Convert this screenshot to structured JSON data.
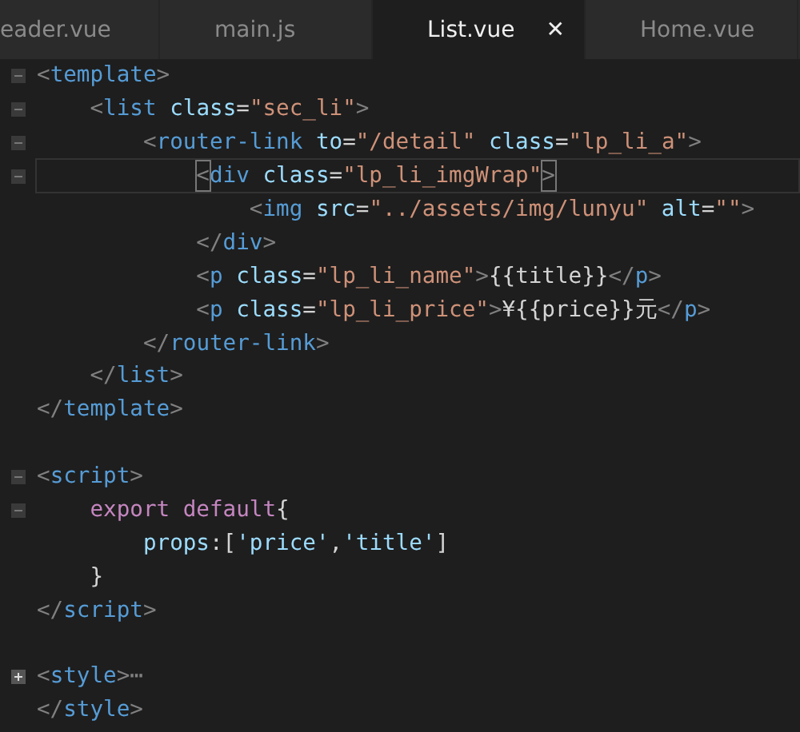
{
  "tabs": [
    {
      "label": "eader.vue",
      "selected": false
    },
    {
      "label": "main.js",
      "selected": false
    },
    {
      "label": "List.vue",
      "selected": true,
      "close": "✕"
    },
    {
      "label": "Home.vue",
      "selected": false
    }
  ],
  "editor": {
    "lines": [
      {
        "expanded": true,
        "current": false,
        "tokens": [
          {
            "kind": "punct",
            "text": "<"
          },
          {
            "kind": "tag",
            "text": "template"
          },
          {
            "kind": "punct",
            "text": ">"
          }
        ]
      },
      {
        "expanded": true,
        "current": false,
        "tokens": [
          {
            "kind": "punct",
            "text": "    <"
          },
          {
            "kind": "tag",
            "text": "list"
          },
          {
            "kind": "attr",
            "text": " class"
          },
          {
            "kind": "text",
            "text": "="
          },
          {
            "kind": "string",
            "text": "\"sec_li\""
          },
          {
            "kind": "punct",
            "text": ">"
          }
        ]
      },
      {
        "expanded": true,
        "current": false,
        "tokens": [
          {
            "kind": "punct",
            "text": "        <"
          },
          {
            "kind": "tag",
            "text": "router-link"
          },
          {
            "kind": "attr",
            "text": " to"
          },
          {
            "kind": "text",
            "text": "="
          },
          {
            "kind": "string",
            "text": "\"/detail\""
          },
          {
            "kind": "attr",
            "text": " class"
          },
          {
            "kind": "text",
            "text": "="
          },
          {
            "kind": "string",
            "text": "\"lp_li_a\""
          },
          {
            "kind": "punct",
            "text": ">"
          }
        ]
      },
      {
        "expanded": true,
        "current": true,
        "tokens": [
          {
            "kind": "match",
            "text": "            <"
          },
          {
            "kind": "tag",
            "text": "div"
          },
          {
            "kind": "attr",
            "text": " class"
          },
          {
            "kind": "text",
            "text": "="
          },
          {
            "kind": "string",
            "text": "\"lp_li_imgWrap\""
          },
          {
            "kind": "match",
            "text": ">"
          }
        ]
      },
      {
        "current": false,
        "tokens": [
          {
            "kind": "punct",
            "text": "                <"
          },
          {
            "kind": "tag",
            "text": "img"
          },
          {
            "kind": "attr",
            "text": " src"
          },
          {
            "kind": "text",
            "text": "="
          },
          {
            "kind": "string",
            "text": "\"../assets/img/lunyu\""
          },
          {
            "kind": "attr",
            "text": " alt"
          },
          {
            "kind": "text",
            "text": "="
          },
          {
            "kind": "string",
            "text": "\"\""
          },
          {
            "kind": "punct",
            "text": ">"
          }
        ]
      },
      {
        "current": false,
        "tokens": [
          {
            "kind": "punct",
            "text": "            </"
          },
          {
            "kind": "tag",
            "text": "div"
          },
          {
            "kind": "punct",
            "text": ">"
          }
        ]
      },
      {
        "current": false,
        "tokens": [
          {
            "kind": "punct",
            "text": "            <"
          },
          {
            "kind": "tag",
            "text": "p"
          },
          {
            "kind": "attr",
            "text": " class"
          },
          {
            "kind": "text",
            "text": "="
          },
          {
            "kind": "string",
            "text": "\"lp_li_name\""
          },
          {
            "kind": "punct",
            "text": ">"
          },
          {
            "kind": "text",
            "text": "{{title}}"
          },
          {
            "kind": "punct",
            "text": "</"
          },
          {
            "kind": "tag",
            "text": "p"
          },
          {
            "kind": "punct",
            "text": ">"
          }
        ]
      },
      {
        "current": false,
        "tokens": [
          {
            "kind": "punct",
            "text": "            <"
          },
          {
            "kind": "tag",
            "text": "p"
          },
          {
            "kind": "attr",
            "text": " class"
          },
          {
            "kind": "text",
            "text": "="
          },
          {
            "kind": "string",
            "text": "\"lp_li_price\""
          },
          {
            "kind": "punct",
            "text": ">"
          },
          {
            "kind": "text",
            "text": "¥{{price}}元"
          },
          {
            "kind": "punct",
            "text": "</"
          },
          {
            "kind": "tag",
            "text": "p"
          },
          {
            "kind": "punct",
            "text": ">"
          }
        ]
      },
      {
        "current": false,
        "tokens": [
          {
            "kind": "punct",
            "text": "        </"
          },
          {
            "kind": "tag",
            "text": "router-link"
          },
          {
            "kind": "punct",
            "text": ">"
          }
        ]
      },
      {
        "current": false,
        "tokens": [
          {
            "kind": "punct",
            "text": "    </"
          },
          {
            "kind": "tag",
            "text": "list"
          },
          {
            "kind": "punct",
            "text": ">"
          }
        ]
      },
      {
        "current": false,
        "tokens": [
          {
            "kind": "punct",
            "text": "</"
          },
          {
            "kind": "tag",
            "text": "template"
          },
          {
            "kind": "punct",
            "text": ">"
          }
        ]
      },
      {
        "current": false
      },
      {
        "expanded": true,
        "current": false,
        "tokens": [
          {
            "kind": "punct",
            "text": "<"
          },
          {
            "kind": "tag",
            "text": "script"
          },
          {
            "kind": "punct",
            "text": ">"
          }
        ]
      },
      {
        "expanded": true,
        "current": false,
        "tokens": [
          {
            "kind": "keyword",
            "text": "    export default"
          },
          {
            "kind": "text",
            "text": "{"
          }
        ]
      },
      {
        "current": false,
        "tokens": [
          {
            "kind": "attr",
            "text": "        props"
          },
          {
            "kind": "text",
            "text": ":["
          },
          {
            "kind": "attr",
            "text": "'price'"
          },
          {
            "kind": "text",
            "text": ","
          },
          {
            "kind": "attr",
            "text": "'title'"
          },
          {
            "kind": "text",
            "text": "]"
          }
        ]
      },
      {
        "current": false,
        "tokens": [
          {
            "kind": "text",
            "text": "    }"
          }
        ]
      },
      {
        "current": false,
        "tokens": [
          {
            "kind": "punct",
            "text": "</"
          },
          {
            "kind": "tag",
            "text": "script"
          },
          {
            "kind": "punct",
            "text": ">"
          }
        ]
      },
      {
        "current": false
      },
      {
        "expanded": false,
        "current": false,
        "tokens": [
          {
            "kind": "punct",
            "text": "<"
          },
          {
            "kind": "tag",
            "text": "style"
          },
          {
            "kind": "punct",
            "text": ">⋯"
          }
        ]
      },
      {
        "current": false,
        "tokens": [
          {
            "kind": "punct",
            "text": "</"
          },
          {
            "kind": "tag",
            "text": "style"
          },
          {
            "kind": "punct",
            "text": ">"
          }
        ]
      }
    ]
  }
}
